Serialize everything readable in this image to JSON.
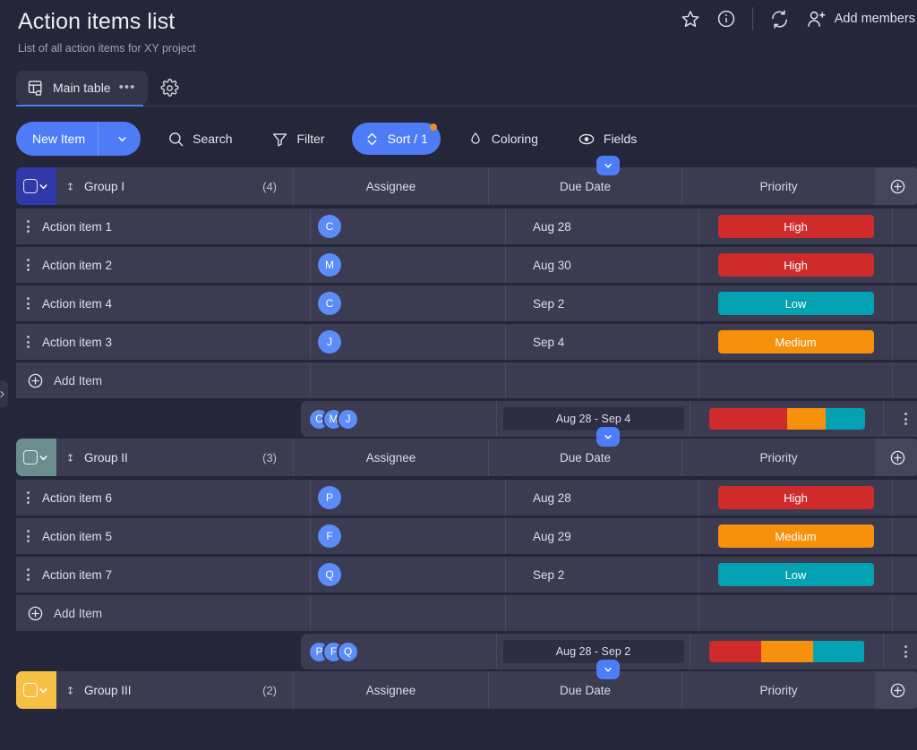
{
  "header": {
    "title": "Action items list",
    "subtitle": "List of all action items for XY project",
    "favorite_icon": "star-icon",
    "info_icon": "info-icon",
    "refresh_icon": "refresh-icon",
    "add_member_icon": "person-add-icon",
    "add_member_label": "Add members"
  },
  "tabs": {
    "main_tab_label": "Main table",
    "main_tab_icon": "table-home-icon",
    "main_tab_more": "•••",
    "settings_icon": "gear-icon"
  },
  "toolbar": {
    "new_item_label": "New Item",
    "new_item_caret": "chevron-down-icon",
    "search_label": "Search",
    "filter_label": "Filter",
    "sort_label": "Sort / 1",
    "coloring_label": "Coloring",
    "fields_label": "Fields"
  },
  "columns": {
    "name": "",
    "assignee": "Assignee",
    "due": "Due Date",
    "priority": "Priority"
  },
  "add_item_label": "Add Item",
  "add_column_icon": "plus-circle-icon",
  "colors": {
    "accent_blue": "#4d7cf6",
    "group1": "#2f3aa8",
    "group2": "#6a8e8e",
    "group3": "#f5c043",
    "high": "#cf2b2b",
    "medium": "#f7900b",
    "low": "#03a2b2"
  },
  "groups": [
    {
      "name": "Group I",
      "count": "(4)",
      "color": "#2f3aa8",
      "rows": [
        {
          "name": "Action item 1",
          "assignee": "C",
          "due": "Aug 28",
          "priority": "High",
          "priority_color": "#cf2b2b"
        },
        {
          "name": "Action item 2",
          "assignee": "M",
          "due": "Aug 30",
          "priority": "High",
          "priority_color": "#cf2b2b"
        },
        {
          "name": "Action item 4",
          "assignee": "C",
          "due": "Sep 2",
          "priority": "Low",
          "priority_color": "#03a2b2"
        },
        {
          "name": "Action item 3",
          "assignee": "J",
          "due": "Sep 4",
          "priority": "Medium",
          "priority_color": "#f7900b"
        }
      ],
      "summary": {
        "avatars": [
          "C",
          "M",
          "J"
        ],
        "date_range": "Aug 28 - Sep 4",
        "progress": [
          {
            "label": "High",
            "color": "#cf2b2b",
            "pct": 50
          },
          {
            "label": "Medium",
            "color": "#f7900b",
            "pct": 25
          },
          {
            "label": "Low",
            "color": "#03a2b2",
            "pct": 25
          }
        ]
      }
    },
    {
      "name": "Group II",
      "count": "(3)",
      "color": "#6a8e8e",
      "rows": [
        {
          "name": "Action item 6",
          "assignee": "P",
          "due": "Aug 28",
          "priority": "High",
          "priority_color": "#cf2b2b"
        },
        {
          "name": "Action item 5",
          "assignee": "F",
          "due": "Aug 29",
          "priority": "Medium",
          "priority_color": "#f7900b"
        },
        {
          "name": "Action item 7",
          "assignee": "Q",
          "due": "Sep 2",
          "priority": "Low",
          "priority_color": "#03a2b2"
        }
      ],
      "summary": {
        "avatars": [
          "P",
          "F",
          "Q"
        ],
        "date_range": "Aug 28 - Sep 2",
        "progress": [
          {
            "label": "High",
            "color": "#cf2b2b",
            "pct": 33.4
          },
          {
            "label": "Medium",
            "color": "#f7900b",
            "pct": 33.3
          },
          {
            "label": "Low",
            "color": "#03a2b2",
            "pct": 33.3
          }
        ]
      }
    },
    {
      "name": "Group III",
      "count": "(2)",
      "color": "#f5c043",
      "rows": [],
      "summary": null
    }
  ]
}
